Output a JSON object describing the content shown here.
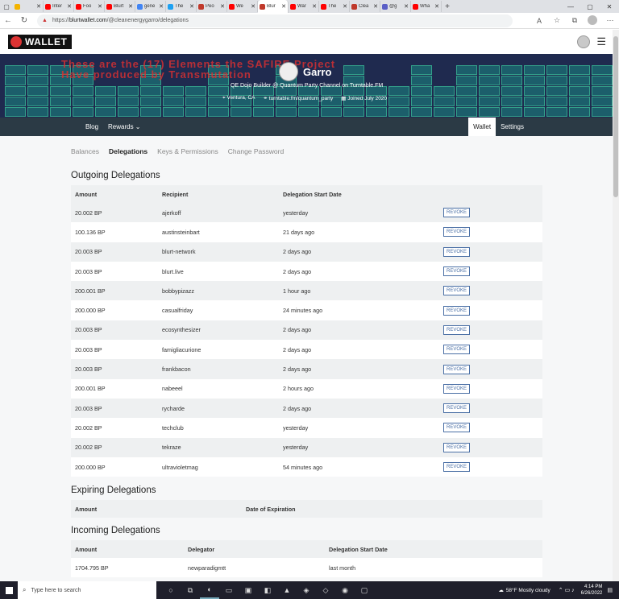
{
  "browser": {
    "tabs": [
      {
        "title": "",
        "color": "#f4b400"
      },
      {
        "title": "Inter",
        "color": "#ff0000"
      },
      {
        "title": "Foo",
        "color": "#ff0000"
      },
      {
        "title": "Blurt",
        "color": "#ff0000"
      },
      {
        "title": "gene",
        "color": "#4285f4"
      },
      {
        "title": "The",
        "color": "#1da1f2"
      },
      {
        "title": "Peo",
        "color": "#c0392b"
      },
      {
        "title": "We",
        "color": "#ff0000"
      },
      {
        "title": "Blur",
        "color": "#c0392b",
        "active": true
      },
      {
        "title": "War",
        "color": "#ff0000"
      },
      {
        "title": "The",
        "color": "#ff0000"
      },
      {
        "title": "Clea",
        "color": "#c0392b"
      },
      {
        "title": "@g",
        "color": "#5b5fc7"
      },
      {
        "title": "Wha",
        "color": "#ff0000"
      }
    ],
    "url_prefix": "https://",
    "url_host": "blurtwallet.com",
    "url_path": "/@cleanenergygarro/delegations"
  },
  "app": {
    "logo_text": "WALLET"
  },
  "banner": {
    "red_line1": "These are the (17) Elements the SAFIRE Project",
    "red_line2": "Have produced by Transmutation",
    "name": "Garro",
    "bio": "QE Dojo Builder @ Quantum Party Channel on Turntable.FM",
    "location": "Ventura, CA",
    "website": "turntable.fm/quantum_party",
    "joined": "Joined July 2020"
  },
  "nav": {
    "blog": "Blog",
    "rewards": "Rewards ⌄",
    "wallet": "Wallet",
    "settings": "Settings"
  },
  "subtabs": [
    "Balances",
    "Delegations",
    "Keys & Permissions",
    "Change Password"
  ],
  "outgoing": {
    "title": "Outgoing Delegations",
    "headers": [
      "Amount",
      "Recipient",
      "Delegation Start Date"
    ],
    "revoke_label": "REVOKE",
    "rows": [
      [
        "20.002 BP",
        "ajerkoff",
        "yesterday"
      ],
      [
        "100.136 BP",
        "austinsteinbart",
        "21 days ago"
      ],
      [
        "20.003 BP",
        "blurt-network",
        "2 days ago"
      ],
      [
        "20.003 BP",
        "blurt.live",
        "2 days ago"
      ],
      [
        "200.001 BP",
        "bobbypizazz",
        "1 hour ago"
      ],
      [
        "200.000 BP",
        "casualfriday",
        "24 minutes ago"
      ],
      [
        "20.003 BP",
        "ecosynthesizer",
        "2 days ago"
      ],
      [
        "20.003 BP",
        "famigliacurione",
        "2 days ago"
      ],
      [
        "20.003 BP",
        "frankbacon",
        "2 days ago"
      ],
      [
        "200.001 BP",
        "nabeeel",
        "2 hours ago"
      ],
      [
        "20.003 BP",
        "rycharde",
        "2 days ago"
      ],
      [
        "20.002 BP",
        "techclub",
        "yesterday"
      ],
      [
        "20.002 BP",
        "tekraze",
        "yesterday"
      ],
      [
        "200.000 BP",
        "ultravioletmag",
        "54 minutes ago"
      ]
    ]
  },
  "expiring": {
    "title": "Expiring Delegations",
    "headers": [
      "Amount",
      "Date of Expiration"
    ]
  },
  "incoming": {
    "title": "Incoming Delegations",
    "headers": [
      "Amount",
      "Delegator",
      "Delegation Start Date"
    ],
    "rows": [
      [
        "1704.795 BP",
        "newparadigmtt",
        "last month"
      ]
    ]
  },
  "taskbar": {
    "search_placeholder": "Type here to search",
    "weather": "58°F  Mostly cloudy",
    "time": "4:14 PM",
    "date": "6/26/2022"
  }
}
